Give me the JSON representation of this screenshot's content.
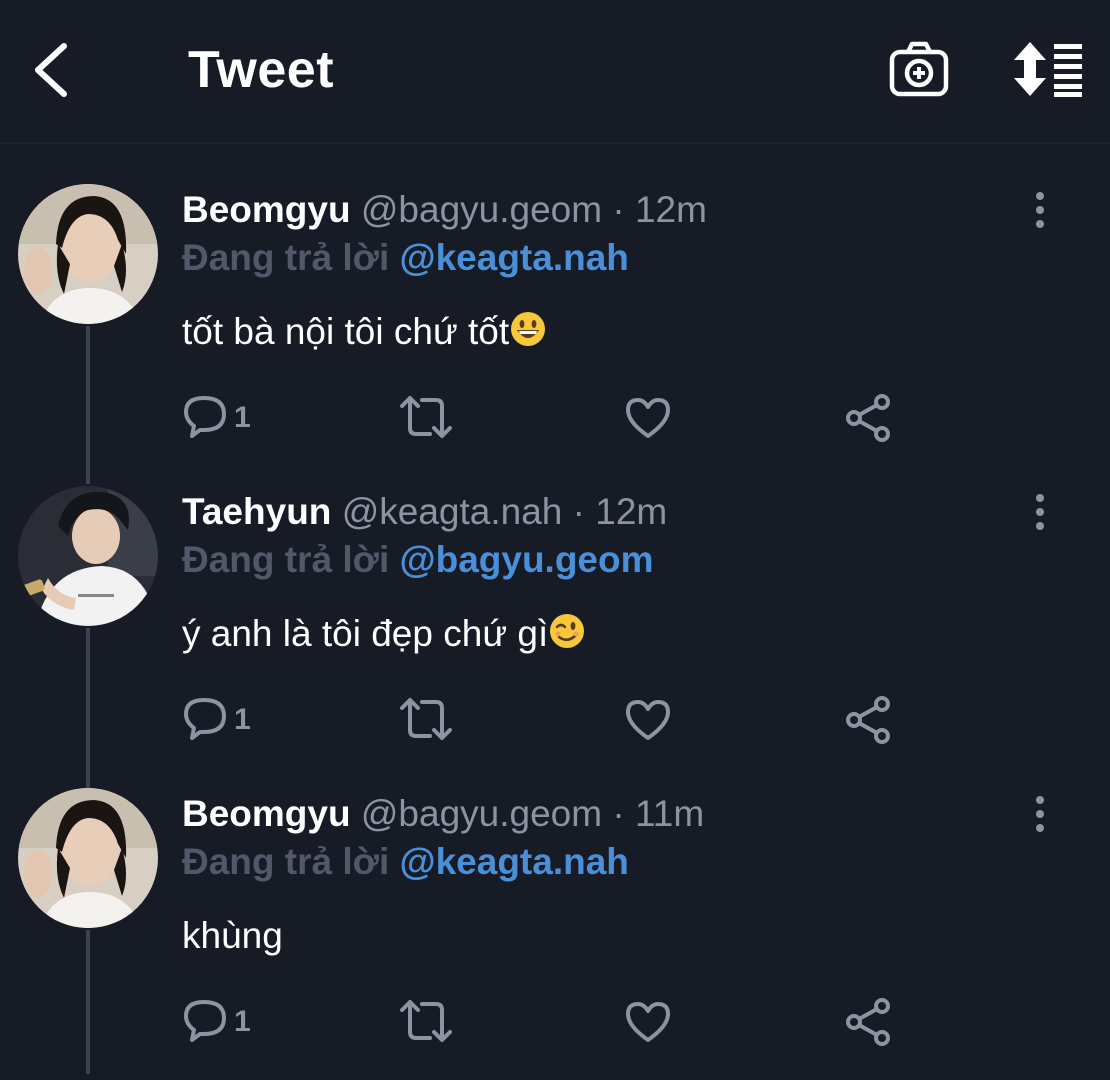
{
  "header": {
    "title": "Tweet",
    "back_icon": "chevron-left-icon",
    "camera_icon": "camera-add-icon",
    "sort_icon": "sort-list-icon"
  },
  "colors": {
    "background": "#171b26",
    "text": "#ffffff",
    "muted": "#8c94a3",
    "reply_prefix": "#505969",
    "mention": "#4a90d9"
  },
  "tweets": [
    {
      "name": "Beomgyu",
      "handle": "@bagyu.geom",
      "separator": "·",
      "time": "12m",
      "reply_prefix": "Đang trả lời",
      "reply_to": "@keagta.nah",
      "text": "tốt bà nội tôi chứ tốt",
      "emoji": "grinning-face-emoji",
      "reply_count": "1"
    },
    {
      "name": "Taehyun",
      "handle": "@keagta.nah",
      "separator": "·",
      "time": "12m",
      "reply_prefix": "Đang trả lời",
      "reply_to": "@bagyu.geom",
      "text": "ý anh là tôi đẹp chứ gì",
      "emoji": "winking-face-emoji",
      "reply_count": "1"
    },
    {
      "name": "Beomgyu",
      "handle": "@bagyu.geom",
      "separator": "·",
      "time": "11m",
      "reply_prefix": "Đang trả lời",
      "reply_to": "@keagta.nah",
      "text": "khùng",
      "emoji": "",
      "reply_count": "1"
    }
  ]
}
